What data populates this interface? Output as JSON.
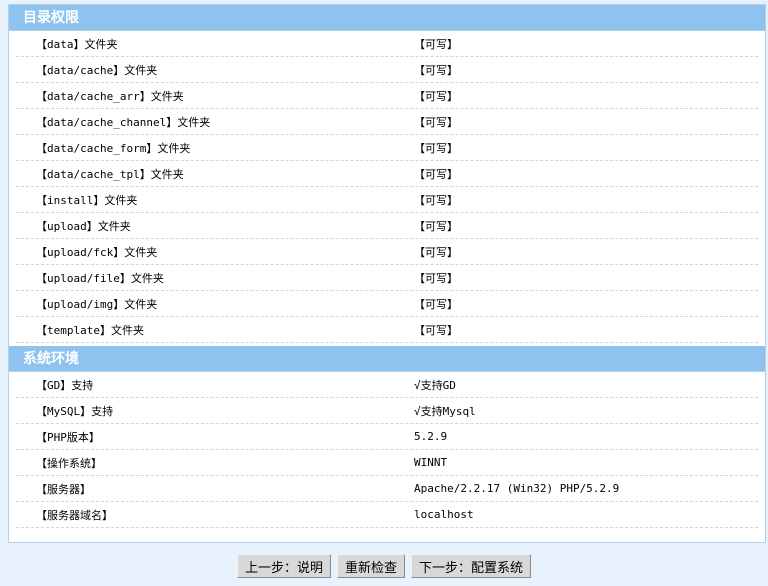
{
  "directory_section": {
    "title": "目录权限",
    "rows": [
      {
        "label": "【data】文件夹",
        "value": "【可写】"
      },
      {
        "label": "【data/cache】文件夹",
        "value": "【可写】"
      },
      {
        "label": "【data/cache_arr】文件夹",
        "value": "【可写】"
      },
      {
        "label": "【data/cache_channel】文件夹",
        "value": "【可写】"
      },
      {
        "label": "【data/cache_form】文件夹",
        "value": "【可写】"
      },
      {
        "label": "【data/cache_tpl】文件夹",
        "value": "【可写】"
      },
      {
        "label": "【install】文件夹",
        "value": "【可写】"
      },
      {
        "label": "【upload】文件夹",
        "value": "【可写】"
      },
      {
        "label": "【upload/fck】文件夹",
        "value": "【可写】"
      },
      {
        "label": "【upload/file】文件夹",
        "value": "【可写】"
      },
      {
        "label": "【upload/img】文件夹",
        "value": "【可写】"
      },
      {
        "label": "【template】文件夹",
        "value": "【可写】"
      }
    ]
  },
  "system_section": {
    "title": "系统环境",
    "rows": [
      {
        "label": "【GD】支持",
        "value": "√支持GD"
      },
      {
        "label": "【MySQL】支持",
        "value": "√支持Mysql"
      },
      {
        "label": "【PHP版本】",
        "value": "5.2.9"
      },
      {
        "label": "【操作系统】",
        "value": "WINNT"
      },
      {
        "label": "【服务器】",
        "value": "Apache/2.2.17 (Win32) PHP/5.2.9"
      },
      {
        "label": "【服务器域名】",
        "value": "localhost"
      }
    ]
  },
  "buttons": {
    "prev": "上一步：说明",
    "recheck": "重新检查",
    "next": "下一步：配置系统"
  }
}
